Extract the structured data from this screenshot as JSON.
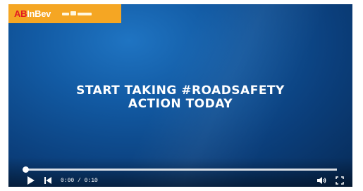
{
  "logo": {
    "brand_part1": "AB",
    "brand_part2": "InBev"
  },
  "video": {
    "headline_line1": "START TAKING #ROADSAFETY",
    "headline_line2": "ACTION TODAY",
    "progress_fraction": 0.0
  },
  "controls": {
    "time": "0:00 / 0:10",
    "play_icon": "play-icon",
    "prev_icon": "skip-back-icon",
    "volume_icon": "volume-icon",
    "fullscreen_icon": "fullscreen-icon"
  },
  "colors": {
    "logo_background": "#f5a623",
    "logo_text": "#e21b23",
    "video_background": "#0b3f7c"
  }
}
